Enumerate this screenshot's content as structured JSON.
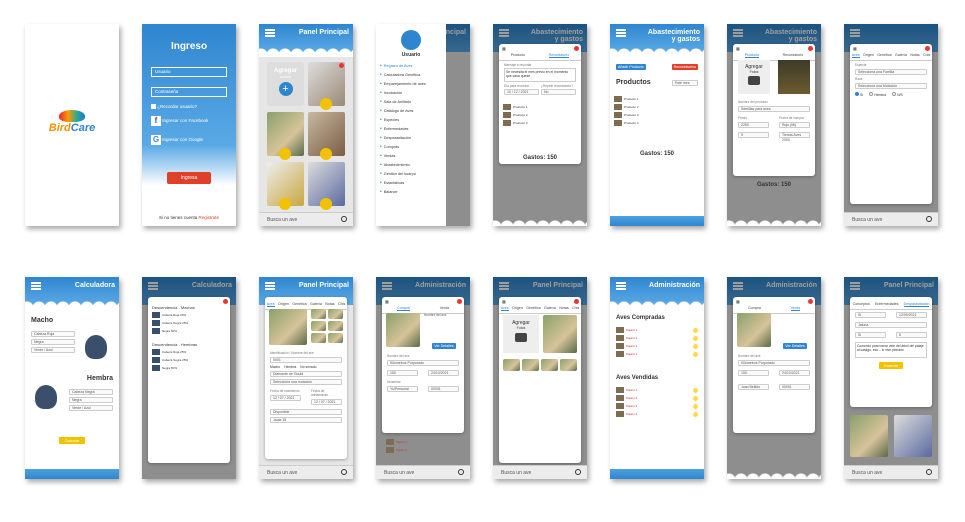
{
  "splash": {
    "logo_left": "Bird",
    "logo_right": "Care"
  },
  "login": {
    "title": "Ingreso",
    "user_placeholder": "Usuario",
    "pass_placeholder": "Contraseña",
    "remember": "¿Recordar usuario?",
    "facebook": "Ingresar con Facebook",
    "google": "Ingresar con Google",
    "submit": "Ingresa",
    "no_account": "Si no tienes cuenta",
    "register": "Registrate"
  },
  "panel": {
    "title": "Panel Principal",
    "add_label": "Agregar",
    "add_sub": "nuevo",
    "search": "Busca un ave"
  },
  "menu": {
    "user": "Usuario",
    "items": [
      "Registro de Aves",
      "Calculadora Genética",
      "Emparejamiento de aves",
      "Incubación",
      "Sala de Anillado",
      "Catálogo de Aves",
      "Especies",
      "Enfermedades",
      "Desparasitación",
      "Compras",
      "Ventas",
      "Abastecimiento",
      "Gestión del huarpo",
      "Estadísticas",
      "Balance"
    ]
  },
  "abast": {
    "title_l1": "Abastecimiento",
    "title_l2": "y gastos",
    "tab_product": "Producto",
    "tab_records": "Recordatorio",
    "reminder_label": "Mensaje a recordar",
    "reminder_text": "Se necesita el mes previo en el momento que casa quede",
    "date_label": "Día para recordar",
    "repeat_label": "¿Repetir recordatorio?",
    "date_value": "10 / 12 / 2021",
    "repeat_value": "No",
    "gastos": "Gastos: 150",
    "add_product": "Añadir Producto",
    "records_btn": "Recordatorios",
    "products": "Productos",
    "this_month": "Este mes",
    "item_label": "Agregar",
    "item_sub": "Fotos",
    "name_label": "Nombre del producto",
    "name_value": "Semillas para aves",
    "price_label": "Precio",
    "price_value": "2250",
    "date2_label": "Fecha de compra",
    "date2_value": "Rojo (Ml)",
    "qty_value": "5",
    "tag_value": "Tienda Aves 2000"
  },
  "form_tabs": [
    "Aves",
    "Origen",
    "Genética",
    "Galería",
    "Notas",
    "Chis"
  ],
  "registro": {
    "especie_label": "Especie",
    "especie_value": "Selecciona una Familia",
    "raza_label": "Raza",
    "raza_value": "Selecciona una Mutación",
    "sex_options": [
      "Sí",
      "Hembra",
      "N/S"
    ]
  },
  "calc": {
    "title": "Calculadora",
    "macho": "Macho",
    "hembra": "Hembra",
    "sel_a": "Cabeza Roja",
    "sel_b": "Negra",
    "sel_c": "Verde / Azul",
    "sel_d": "Cabeza Negra",
    "sel_e": "Negra",
    "sel_f": "Verde / Azul",
    "calcular": "Calcular",
    "result_m": "Descendencia - Machos",
    "result_h": "Descendencia - Hembras"
  },
  "ave": {
    "ficha_label": "Identificación / Nombre del ave",
    "ficha_value": "0001",
    "sex_m": "Macho",
    "sex_h": "Hembra",
    "sex_n": "No sexado",
    "especie": "Diamante de Gould",
    "mutation": "Selecciona una mutación",
    "hatch_label": "Fecha de nacimiento",
    "hatch_value": "12 / 07 / 2021",
    "ring_label": "Fecha de anillamiento",
    "ring_value": "12 / 07 / 2021",
    "status": "Disponible",
    "cage_value": "Jaula 15"
  },
  "admin": {
    "title": "Administración",
    "tab_buy": "Compra",
    "tab_sell": "Venta",
    "detail_btn": "Ver Detalles",
    "name_label": "Nombre del ave",
    "name_value": "Kilómetros Purpurado",
    "price_value": "150",
    "date_value": "24/10/2021",
    "seller_label": "Vendedor",
    "seller_value": "Yo/Personal",
    "buyer_value": "Juan Bellido",
    "code_value": "00001",
    "compradas": "Aves Compradas",
    "vendidas": "Aves Vendidas"
  },
  "notas": {
    "tabs": [
      "Conceptos",
      "Enfermedades",
      "Desparasitación"
    ],
    "sel1": "Sí",
    "date1": "12/09/2021",
    "person": "Jaiuna",
    "qty_value": "6",
    "text": "Comenzó para tomar vete del árbol del palaje al castigo, eso... lo vive peinado",
    "save_btn": "Guardar"
  },
  "colors": {
    "blue": "#2f86cf",
    "sky": "#5aa9e6",
    "red": "#e0402a",
    "yellow": "#f2c200"
  }
}
